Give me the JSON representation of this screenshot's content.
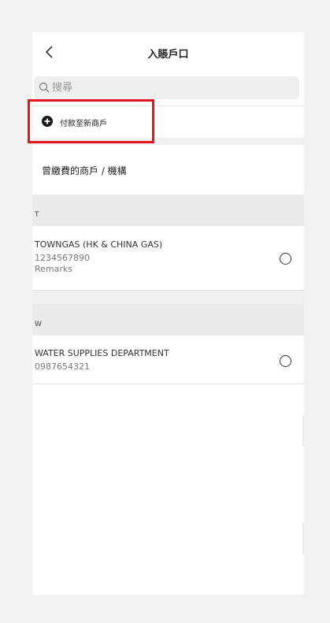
{
  "header": {
    "title": "入賬戶口"
  },
  "search": {
    "placeholder": "搜尋",
    "value": ""
  },
  "add_merchant": {
    "label": "付款至新商戶"
  },
  "section": {
    "title": "曾繳費的商戶 / 機構"
  },
  "groups": [
    {
      "letter": "T",
      "items": [
        {
          "name": "TOWNGAS (HK & CHINA GAS)",
          "account": "1234567890",
          "remarks": "Remarks"
        }
      ]
    },
    {
      "letter": "W",
      "items": [
        {
          "name": "WATER SUPPLIES DEPARTMENT",
          "account": "0987654321"
        }
      ]
    }
  ],
  "colors": {
    "highlight": "#e2161e",
    "background": "#f2f2f2"
  },
  "icons": [
    "chevron-left-icon",
    "search-icon",
    "plus-circle-icon",
    "radio-unselected-icon"
  ]
}
